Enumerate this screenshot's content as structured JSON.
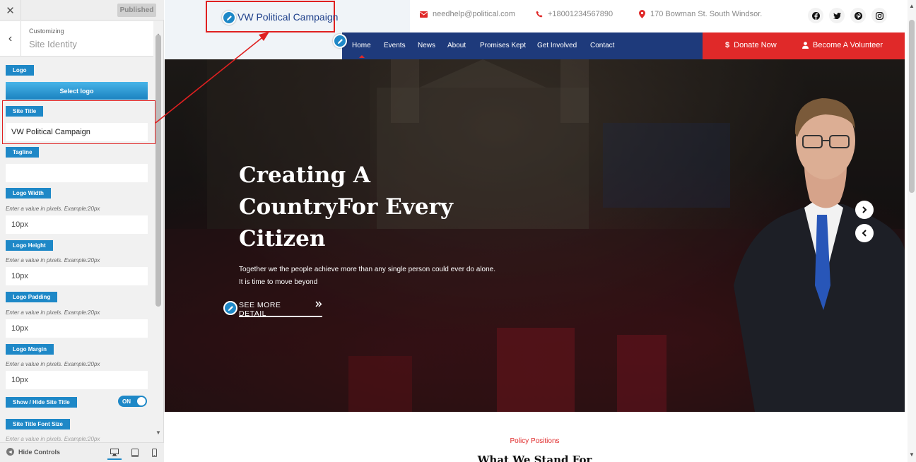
{
  "customizer": {
    "published_label": "Published",
    "customizing_label": "Customizing",
    "section_title": "Site Identity",
    "logo_label": "Logo",
    "select_logo_label": "Select logo",
    "site_title_label": "Site Title",
    "site_title_value": "VW Political Campaign",
    "tagline_label": "Tagline",
    "tagline_value": "",
    "logo_width_label": "Logo Width",
    "logo_width_hint": "Enter a value in pixels. Example:20px",
    "logo_width_value": "10px",
    "logo_height_label": "Logo Height",
    "logo_height_hint": "Enter a value in pixels. Example:20px",
    "logo_height_value": "10px",
    "logo_padding_label": "Logo Padding",
    "logo_padding_hint": "Enter a value in pixels. Example:20px",
    "logo_padding_value": "10px",
    "logo_margin_label": "Logo Margin",
    "logo_margin_hint": "Enter a value in pixels. Example:20px",
    "logo_margin_value": "10px",
    "show_hide_label": "Show / Hide Site Title",
    "toggle_state": "ON",
    "font_size_label": "Site Title Font Size",
    "font_size_hint": "Enter a value in pixels. Example:20px",
    "hide_controls_label": "Hide Controls"
  },
  "site": {
    "logo_text": "VW Political Campaign",
    "email": "needhelp@political.com",
    "phone": "+18001234567890",
    "address": "170 Bowman St. South Windsor.",
    "nav": [
      "Home",
      "Events",
      "News",
      "About",
      "Promises Kept",
      "Get Involved",
      "Contact"
    ],
    "donate_label": "Donate Now",
    "volunteer_label": "Become A Volunteer",
    "hero_title": "Creating A CountryFor Every Citizen",
    "hero_text": "Together we the people achieve more than any single person could ever do alone. It is time to move beyond",
    "hero_button": "SEE MORE DETAIL",
    "policy_kicker": "Policy Positions",
    "policy_title": "What We Stand For"
  },
  "colors": {
    "accent_blue": "#1e88c7",
    "nav_navy": "#1e3a7b",
    "brand_red": "#e02929",
    "highlight_red": "#e02020"
  },
  "icons": {
    "close": "close-icon",
    "back": "chevron-left-icon",
    "edit": "pencil-icon",
    "email": "envelope-icon",
    "phone": "phone-icon",
    "address": "map-pin-icon",
    "social": [
      "facebook-icon",
      "twitter-icon",
      "pinterest-icon",
      "instagram-icon"
    ],
    "devices": [
      "desktop-icon",
      "tablet-icon",
      "mobile-icon"
    ]
  }
}
